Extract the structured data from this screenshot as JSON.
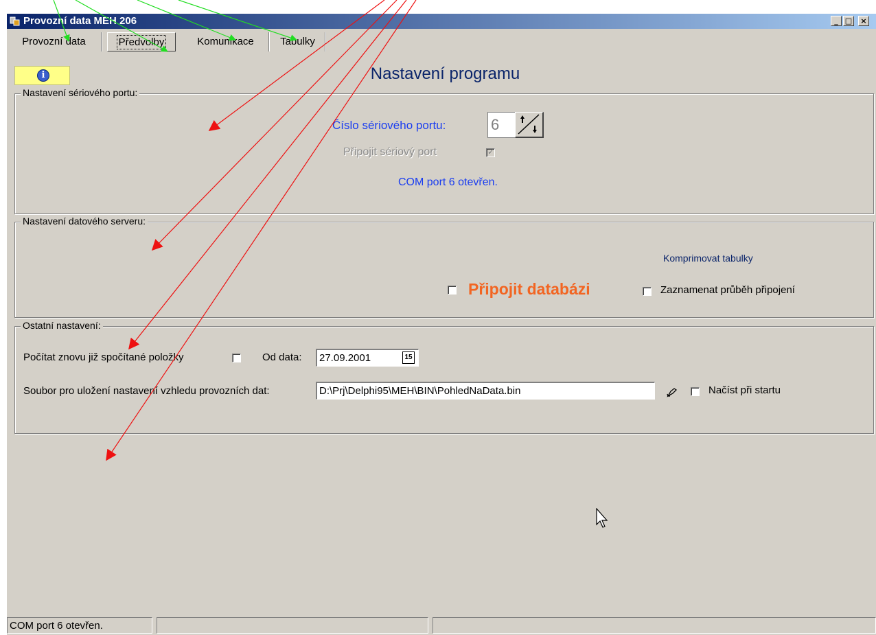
{
  "window": {
    "title": "Provozní data MEH 206",
    "icon": "app-icon"
  },
  "controls": {
    "minimize": "_",
    "maximize": "□",
    "close": "×"
  },
  "tabs": [
    {
      "label": "Provozní data"
    },
    {
      "label": "Předvolby",
      "active": true
    },
    {
      "label": "Komunikace"
    },
    {
      "label": "Tabulky"
    }
  ],
  "header": {
    "title": "Nastavení programu",
    "info_icon": "info-icon"
  },
  "serial": {
    "title": "Nastavení sériového portu:",
    "port_label": "Číslo sériového portu:",
    "port_value": "6",
    "connect_label": "Připojit sériový port",
    "connect_checked": true,
    "status": "COM port 6 otevřen."
  },
  "dataserver": {
    "title": "Nastavení datového serveru:",
    "compress_link": "Komprimovat tabulky",
    "connect_db_label": "Připojit databázi",
    "log_label": "Zaznamenat průběh připojení"
  },
  "other": {
    "title": "Ostatní nastavení:",
    "recalc_label": "Počítat znovu již spočítané položky",
    "from_label": "Od data:",
    "from_value": "27.09.2001",
    "calendar_btn": "15",
    "file_label": "Soubor pro uložení nastavení vzhledu provozních dat:",
    "file_value": "D:\\Prj\\Delphi95\\MEH\\BIN\\PohledNaData.bin",
    "load_label": "Načíst při startu"
  },
  "status_bar": {
    "panel1": "COM port 6 otevřen.",
    "panel2": "",
    "panel3": ""
  },
  "colors": {
    "annotation_green": "#22dd22",
    "annotation_red": "#ee1111",
    "title_navy": "#0a246a",
    "accent_orange": "#f26522",
    "link_blue": "#1a3df0"
  }
}
